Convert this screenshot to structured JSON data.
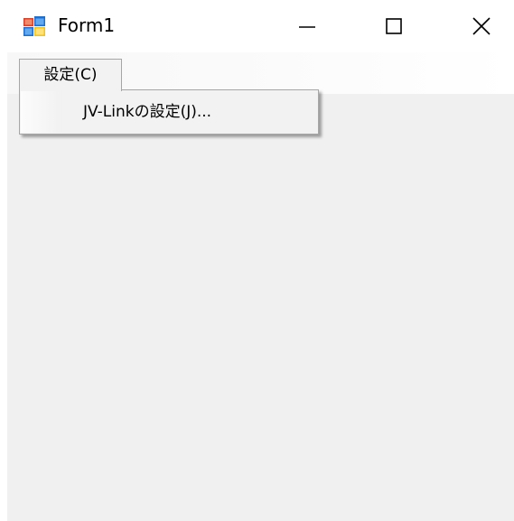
{
  "window": {
    "title": "Form1",
    "icon": "winforms-app-icon",
    "controls": {
      "minimize": "minimize-icon",
      "maximize": "maximize-icon",
      "close": "close-icon"
    }
  },
  "menubar": {
    "items": [
      {
        "label": "設定(C)",
        "open": true,
        "submenu": [
          {
            "label": "JV-Linkの設定(J)..."
          }
        ]
      }
    ]
  },
  "colors": {
    "client_background": "#f0f0f0",
    "menu_border": "#a6a6a6",
    "icon_red": "#d9412b",
    "icon_blue": "#1e6fd0",
    "icon_yellow": "#f4c21d"
  }
}
